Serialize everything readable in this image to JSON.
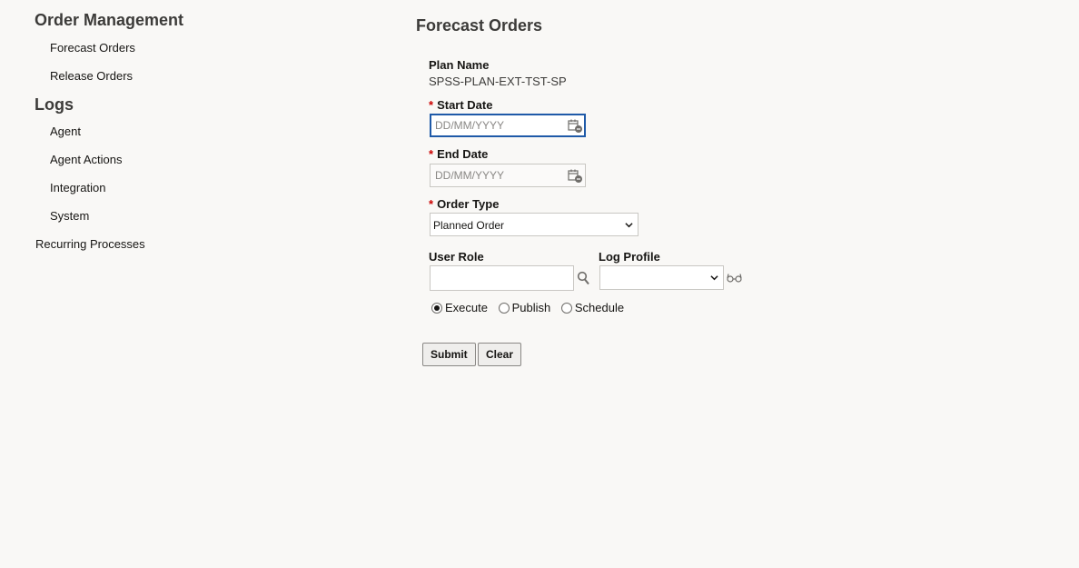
{
  "sidebar": {
    "order_management": {
      "title": "Order Management",
      "items": [
        "Forecast Orders",
        "Release Orders"
      ]
    },
    "logs": {
      "title": "Logs",
      "items": [
        "Agent",
        "Agent Actions",
        "Integration",
        "System"
      ]
    },
    "recurring": "Recurring Processes"
  },
  "main": {
    "title": "Forecast Orders",
    "plan_name": {
      "label": "Plan Name",
      "value": "SPSS-PLAN-EXT-TST-SP"
    },
    "start_date": {
      "required": "*",
      "label": "Start Date",
      "placeholder": "DD/MM/YYYY",
      "value": ""
    },
    "end_date": {
      "required": "*",
      "label": "End Date",
      "placeholder": "DD/MM/YYYY",
      "value": ""
    },
    "order_type": {
      "required": "*",
      "label": "Order Type",
      "selected": "Planned Order"
    },
    "user_role": {
      "label": "User Role",
      "value": ""
    },
    "log_profile": {
      "label": "Log Profile",
      "selected": ""
    },
    "mode": {
      "options": [
        "Execute",
        "Publish",
        "Schedule"
      ],
      "selected": "Execute"
    },
    "buttons": {
      "submit": "Submit",
      "clear": "Clear"
    }
  },
  "icons": {
    "calendar": "calendar-icon",
    "search": "search-icon",
    "glasses": "glasses-icon",
    "chevron": "chevron-down-icon"
  }
}
